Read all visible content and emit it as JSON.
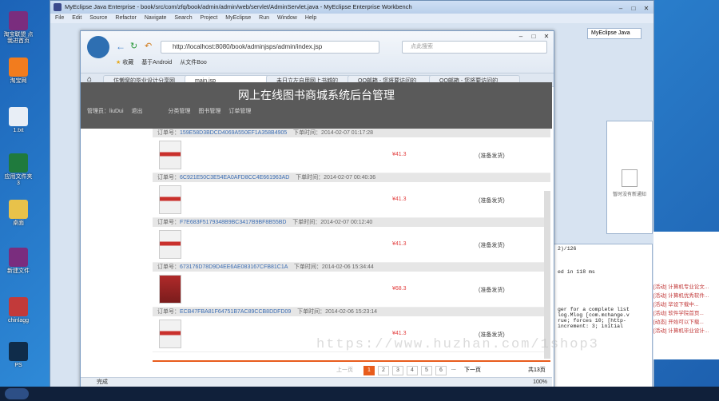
{
  "desktop": {
    "icons": [
      "淘宝联盟\n点我进首页",
      "淘宝网",
      "搜狗",
      "1.txt",
      "WPS",
      "应用文件夹3",
      "2013",
      "奇迹画图",
      "桌面",
      "新建文件",
      "Kerakteros",
      "Word",
      "chinlagg",
      "PS",
      "2.psd"
    ]
  },
  "eclipse": {
    "title": "MyEclipse Java Enterprise - book/src/com/zfq/book/admin/admin/web/servlet/AdminServlet.java - MyEclipse Enterprise Workbench",
    "menu": [
      "File",
      "Edit",
      "Source",
      "Refactor",
      "Navigate",
      "Search",
      "Project",
      "MyEclipse",
      "Run",
      "Window",
      "Help"
    ],
    "perspective": "MyEclipse Java",
    "no_notice": "暂时没有新通知",
    "console_time": "2)/126",
    "console_lines": [
      "ed in 118 ms",
      "ger for a complete list",
      "log.Mlog [com.mchange.v",
      "rue; forces 10; [http-",
      "increment: 3; initial"
    ],
    "panel_items": [
      "电影",
      "文件",
      "更多",
      "[活动] 计算机专业论文...",
      "[活动] 计算机优秀软件...",
      "[活动] 毕设下载中...",
      "[活动] 软件学院首页...",
      "[动态] 开始可以下载...",
      "[活动] 计算机毕业设计...",
      "[活动] 2014年最新毕业..."
    ]
  },
  "browser": {
    "url": "http://localhost:8080/book/adminjsps/admin/index.jsp",
    "search_placeholder": "点此搜索",
    "favorites": [
      "收藏",
      "基于Android",
      "从文件Boo"
    ],
    "tabs": [
      "仿懒窝的毕业设计分享网",
      "main.jsp",
      "未日立左自用网上书城的",
      "QQ邮箱 - 您将要访问的",
      "QQ邮箱 - 您将要访问的"
    ],
    "status_text": "完成",
    "zoom": "100%"
  },
  "site": {
    "title": "网上在线图书商城系统后台管理",
    "admin_label": "管理员：liuDui",
    "logout": "退出",
    "nav": [
      "分类管理",
      "图书管理",
      "订单管理"
    ],
    "orders": [
      {
        "no_label": "订单号：",
        "no": "159E58D3BDCD4069A550EF1A358B4905",
        "time_label": "下单时间：",
        "time": "2014-02-07 01:17:28",
        "price": "¥41.3",
        "status": "(准备发货)"
      },
      {
        "no_label": "订单号：",
        "no": "6C921E50C3E54EA0AFD8CC4E661963AD",
        "time_label": "下单时间：",
        "time": "2014-02-07 00:40:36",
        "price": "¥41.3",
        "status": "(准备发货)"
      },
      {
        "no_label": "订单号：",
        "no": "F7E683F5179348B9BC3417B9BF8B55BD",
        "time_label": "下单时间：",
        "time": "2014-02-07 00:12:40",
        "price": "¥41.3",
        "status": "(准备发货)"
      },
      {
        "no_label": "订单号：",
        "no": "673176D78D9D4EE6AE083167CFB81C1A",
        "time_label": "下单时间：",
        "time": "2014-02-06 15:34:44",
        "price": "¥68.3",
        "status": "(准备发货)"
      },
      {
        "no_label": "订单号：",
        "no": "ECB47FBA81F64751B7AC89CCB8DDFD09",
        "time_label": "下单时间：",
        "time": "2014-02-06 15:23:14",
        "price": "¥41.3",
        "status": "(准备发货)"
      }
    ],
    "pager": {
      "prev": "上一页",
      "pages": [
        "1",
        "2",
        "3",
        "4",
        "5",
        "6"
      ],
      "ellipsis": "...",
      "next": "下一页",
      "total": "共13页"
    }
  },
  "watermark": "https://www.huzhan.com/1shop3"
}
